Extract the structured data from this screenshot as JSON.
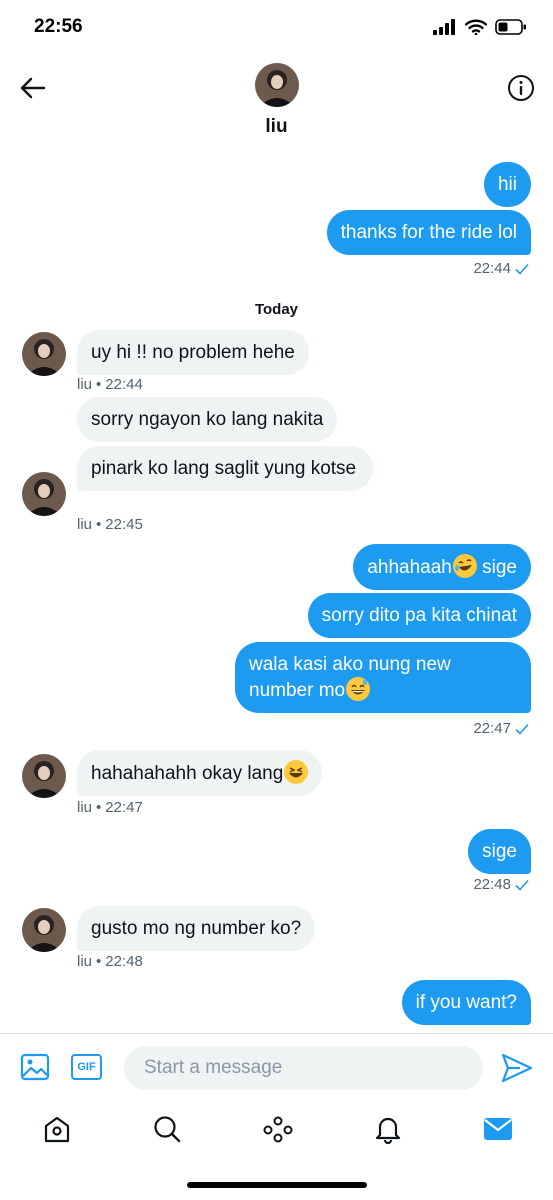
{
  "status_bar": {
    "time": "22:56"
  },
  "header": {
    "name": "liu"
  },
  "day_separator": "Today",
  "messages": [
    {
      "text": "hii"
    },
    {
      "text": "thanks for the ride lol"
    },
    {
      "text": "uy hi !! no problem hehe"
    },
    {
      "text": "sorry ngayon ko lang nakita"
    },
    {
      "text": "pinark ko lang saglit yung kotse"
    },
    {
      "text": "ahhahaah"
    },
    {
      "text": "sige"
    },
    {
      "text": "sorry dito pa kita chinat"
    },
    {
      "text": "wala kasi ako nung new number mo"
    },
    {
      "text": "hahahahahh okay lang"
    },
    {
      "text": "sige"
    },
    {
      "text": "gusto mo ng number ko?"
    },
    {
      "text": "if you want?"
    }
  ],
  "meta": [
    {
      "time": "22:44"
    },
    {
      "sender": "liu",
      "time": "22:44"
    },
    {
      "sender": "liu",
      "time": "22:45"
    },
    {
      "time": "22:47"
    },
    {
      "sender": "liu",
      "time": "22:47"
    },
    {
      "time": "22:48"
    },
    {
      "sender": "liu",
      "time": "22:48"
    }
  ],
  "composer": {
    "placeholder": "Start a message",
    "gif_label": "GIF"
  },
  "icons": {
    "back": "arrow-left-icon",
    "info": "info-icon",
    "media": "image-icon",
    "send": "send-icon",
    "home": "home-icon",
    "search": "search-icon",
    "spaces": "spaces-icon",
    "notifications": "bell-icon",
    "messages": "mail-icon"
  },
  "colors": {
    "accent": "#1d9bf0",
    "incoming_bubble": "#eff3f4",
    "text": "#0f1419",
    "meta_text": "#536471"
  }
}
